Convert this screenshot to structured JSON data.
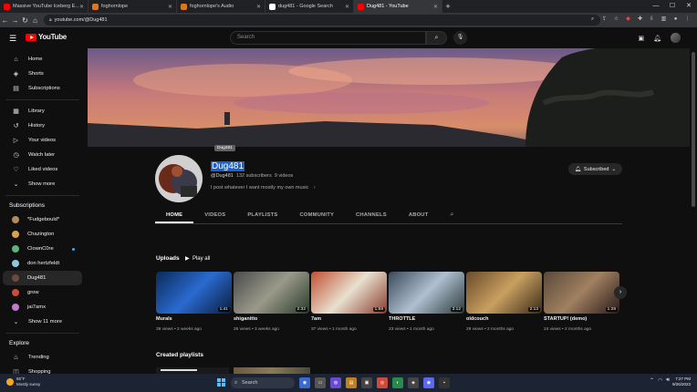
{
  "browser": {
    "tabs": [
      {
        "title": "Massive YouTube Iceberg E...",
        "color": "#ff0000",
        "active": false
      },
      {
        "title": "foghornlope",
        "color": "#e0751b",
        "active": false
      },
      {
        "title": "foghornlope's Audio",
        "color": "#e0751b",
        "active": false
      },
      {
        "title": "dug481 - Google Search",
        "color": "#ffffff",
        "active": false
      },
      {
        "title": "Dug481 - YouTube",
        "color": "#ff0000",
        "active": true
      }
    ],
    "new_tab": "+",
    "url": "youtube.com/@Dug481",
    "window_controls": {
      "minimize": "—",
      "maximize": "☐",
      "close": "✕"
    }
  },
  "youtube_header": {
    "logo_text": "YouTube",
    "search_placeholder": "Search"
  },
  "sidebar": {
    "main": [
      {
        "label": "Home",
        "icon": "⌂",
        "icon_name": "home-icon"
      },
      {
        "label": "Shorts",
        "icon": "◈",
        "icon_name": "shorts-icon"
      },
      {
        "label": "Subscriptions",
        "icon": "▤",
        "icon_name": "subscriptions-icon"
      }
    ],
    "library": [
      {
        "label": "Library",
        "icon": "▦",
        "icon_name": "library-icon"
      },
      {
        "label": "History",
        "icon": "↺",
        "icon_name": "history-icon"
      },
      {
        "label": "Your videos",
        "icon": "▷",
        "icon_name": "your-videos-icon"
      },
      {
        "label": "Watch later",
        "icon": "◷",
        "icon_name": "watch-later-icon"
      },
      {
        "label": "Liked videos",
        "icon": "♡",
        "icon_name": "liked-videos-icon"
      },
      {
        "label": "Show more",
        "icon": "⌄",
        "icon_name": "chevron-down-icon"
      }
    ],
    "subscriptions_heading": "Subscriptions",
    "subscriptions": [
      {
        "label": "*Fudgebould*",
        "color": "#b58a5a",
        "dot": false
      },
      {
        "label": "Chazington",
        "color": "#d8a24a",
        "dot": false
      },
      {
        "label": "ClownC0re",
        "color": "#5fb37a",
        "dot": true
      },
      {
        "label": "don hertzfeldt",
        "color": "#8ec7e0",
        "dot": false
      },
      {
        "label": "Dug481",
        "color": "#6d4a3a",
        "dot": false,
        "active": true
      },
      {
        "label": "grow",
        "color": "#d04a3a",
        "dot": false
      },
      {
        "label": "jai7amx",
        "color": "#c07ad0",
        "dot": false
      }
    ],
    "show_more_subs": "Show 11 more",
    "explore_heading": "Explore",
    "explore": [
      {
        "label": "Trending",
        "icon": "♨",
        "icon_name": "trending-icon"
      },
      {
        "label": "Shopping",
        "icon": "◫",
        "icon_name": "shopping-icon"
      }
    ]
  },
  "channel": {
    "tooltip": "Dug481",
    "name": "Dug481",
    "handle": "@Dug481",
    "subscribers": "132 subscribers",
    "video_count": "9 videos",
    "description": "I post whatever I want mostly my own music",
    "subscribe_label": "Subscribed",
    "tabs": [
      "HOME",
      "VIDEOS",
      "PLAYLISTS",
      "COMMUNITY",
      "CHANNELS",
      "ABOUT"
    ]
  },
  "uploads": {
    "title": "Uploads",
    "play_all": "Play all",
    "videos": [
      {
        "title": "Murals",
        "duration": "1:41",
        "views": "39 views",
        "age": "2 weeks ago",
        "progress": 0.0,
        "colors": [
          "#0a2a5a",
          "#2a6ad0",
          "#0c1c3a"
        ]
      },
      {
        "title": "shiganitto",
        "duration": "2:32",
        "views": "26 views",
        "age": "3 weeks ago",
        "progress": 0.0,
        "colors": [
          "#4a4a4a",
          "#9a9a8a",
          "#2a3a2a"
        ]
      },
      {
        "title": "7am",
        "duration": "1:59",
        "views": "37 views",
        "age": "1 month ago",
        "progress": 0.0,
        "colors": [
          "#c05030",
          "#e8e0d0",
          "#8a3a2a"
        ]
      },
      {
        "title": "THROTTLE",
        "duration": "3:12",
        "views": "23 views",
        "age": "1 month ago",
        "progress": 0.0,
        "colors": [
          "#3a4a5a",
          "#b0c0d0",
          "#2a3a3a"
        ]
      },
      {
        "title": "oldcouch",
        "duration": "2:13",
        "views": "29 views",
        "age": "2 months ago",
        "progress": 0.0,
        "colors": [
          "#6a4a2a",
          "#c8a060",
          "#3a2a1a"
        ]
      },
      {
        "title": "STARTUP! (demo)",
        "duration": "1:28",
        "views": "24 views",
        "age": "2 months ago",
        "progress": 0.0,
        "colors": [
          "#5a4a3a",
          "#a08060",
          "#2a1a1a"
        ]
      }
    ]
  },
  "created_playlists": {
    "title": "Created playlists"
  },
  "taskbar": {
    "weather_temp": "85°F",
    "weather_desc": "Mostly sunny",
    "search_label": "Search",
    "time": "7:27 PM",
    "date": "9/26/2023"
  }
}
